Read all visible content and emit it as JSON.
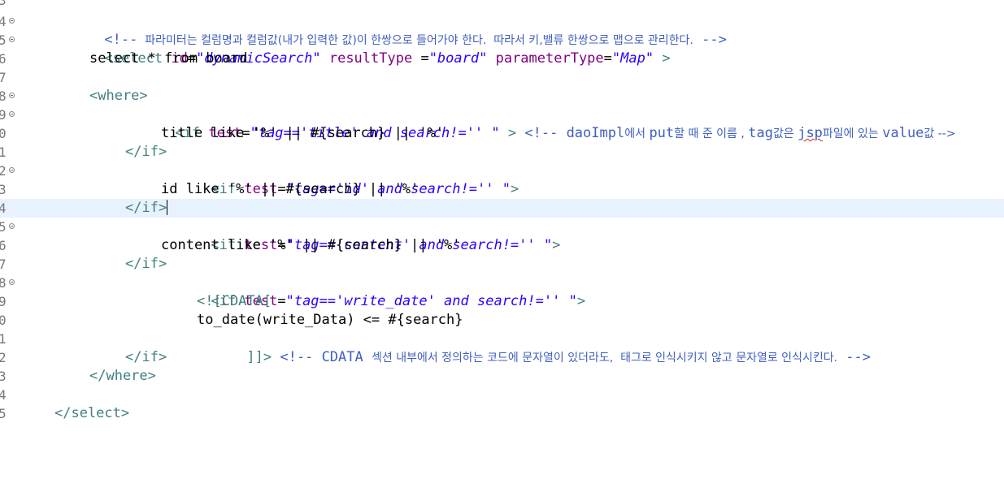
{
  "editor": {
    "lines": [
      {
        "n": "3"
      },
      {
        "n": "4"
      },
      {
        "n": "5"
      },
      {
        "n": "6"
      },
      {
        "n": "7"
      },
      {
        "n": "8"
      },
      {
        "n": "9"
      },
      {
        "n": "0"
      },
      {
        "n": "1"
      },
      {
        "n": "2"
      },
      {
        "n": "3"
      },
      {
        "n": "4"
      },
      {
        "n": "5"
      },
      {
        "n": "6"
      },
      {
        "n": "7"
      },
      {
        "n": "8"
      },
      {
        "n": "9"
      },
      {
        "n": "0"
      },
      {
        "n": "1"
      },
      {
        "n": "2"
      },
      {
        "n": "3"
      },
      {
        "n": "4"
      },
      {
        "n": "5"
      }
    ],
    "code": {
      "l4": {
        "open": "<!--",
        "text": "  파라미터는 컬럼명과 컬럼값(내가 입력한 값)이 한쌍으로 들어가야 한다.  따라서 키,밸류 한쌍으로 맵으로 관리한다.",
        "close": "-->"
      },
      "l5": {
        "tag_open": "<select",
        "a1": "id",
        "v1": "\"dynamicSearch\"",
        "a2": "resultType",
        "eq2": " =",
        "v2": "\"board\"",
        "a3": "parameterType",
        "v3": "\"Map\"",
        "tag_close": " >"
      },
      "l6": {
        "text": "select * from board"
      },
      "l8": {
        "text": "<where>"
      },
      "l9": {
        "tag_open": "<if",
        "a1": "test",
        "v1": "\"tag=='title' and search!='' \"",
        "tag_close": ">",
        "comment_open": "<!-- daoImpl",
        "c1": "에서 ",
        "c2": "put",
        "c3": "할 때 준 이름 , ",
        "c4": "tag",
        "c5": "값은 ",
        "c6": "jsp",
        "c7": "파일에 있는 ",
        "c8": "value",
        "c9": "값 -->"
      },
      "l10": {
        "text": "title like '%' || #{search} || '%'"
      },
      "l11": {
        "text": "</if>"
      },
      "l12": {
        "tag_open": "<if",
        "a1": "test",
        "v1": "\"tag=='id' and search!='' \"",
        "tag_close": ">"
      },
      "l13": {
        "text": "id like '%' || #{search} || '%'"
      },
      "l14": {
        "text": "</if>"
      },
      "l15": {
        "tag_open": "<if",
        "a1": "test",
        "v1": "\"tag=='content' and search!='' \"",
        "tag_close": ">"
      },
      "l16": {
        "text": "content like '%' || #{search} || '%'"
      },
      "l17": {
        "text": "</if>"
      },
      "l18": {
        "tag_open": "<if",
        "a1": "test",
        "v1": "\"tag=='write_date' and search!='' \"",
        "tag_close": ">"
      },
      "l19": {
        "text": "<![CDATA["
      },
      "l20": {
        "text": "to_date(write_Data) <= #{search}"
      },
      "l21": {
        "cdata_close": "]]>",
        "comment_open": "<!-- CDATA ",
        "c1": "섹션 내부에서 정의하는 코드에 문자열이 있더라도,  태그로 인식시키지 않고 문자열로 인식시킨다.",
        "comment_close": " -->"
      },
      "l22": {
        "text": "</if>"
      },
      "l23": {
        "text": "</where>"
      },
      "l25": {
        "text": "</select>"
      }
    }
  },
  "colors": {
    "comment": "#3f5fbf",
    "tag": "#3f7f7f",
    "attribute": "#7f007f",
    "value": "#2a00ff",
    "text": "#000000",
    "current_line": "#e8f2fe"
  }
}
